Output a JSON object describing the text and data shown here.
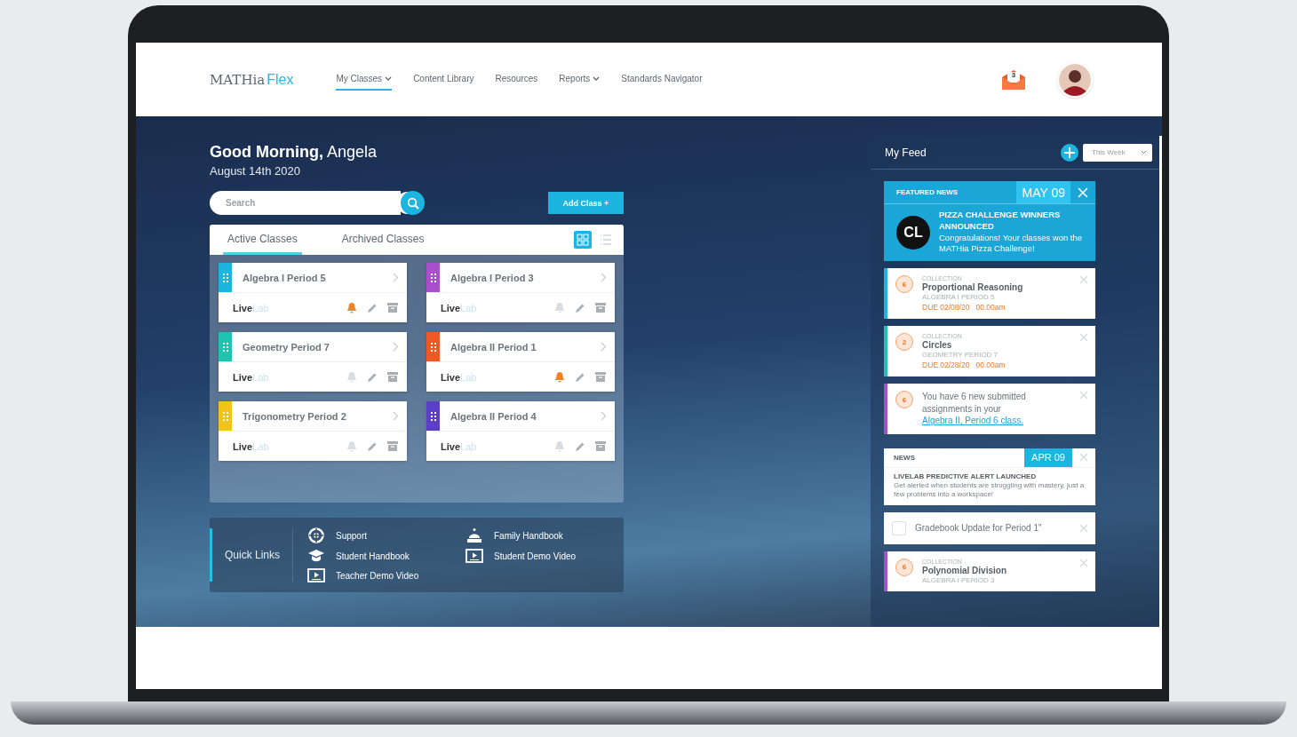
{
  "nav": {
    "logo_main": "MATHia",
    "logo_accent": "Flex",
    "items": [
      {
        "label": "My Classes",
        "selected": true,
        "dropdown": true
      },
      {
        "label": "Content Library",
        "selected": false,
        "dropdown": false
      },
      {
        "label": "Resources",
        "selected": false,
        "dropdown": false
      },
      {
        "label": "Reports",
        "selected": false,
        "dropdown": true
      },
      {
        "label": "Standards Navigator",
        "selected": false,
        "dropdown": false
      }
    ],
    "inbox_count": "3"
  },
  "greeting": {
    "salutation": "Good Morning,",
    "name": "Angela",
    "date": "August 14th 2020"
  },
  "search": {
    "placeholder": "Search"
  },
  "add_button": "Add Class +",
  "class_tabs": [
    {
      "label": "Active Classes",
      "selected": true
    },
    {
      "label": "Archived Classes",
      "selected": false
    }
  ],
  "view_toggle": [
    {
      "kind": "grid",
      "selected": true
    },
    {
      "kind": "list",
      "selected": false
    }
  ],
  "classes": [
    {
      "name": "Algebra I Period 5",
      "color": "#1cb5e0",
      "alert": true,
      "tool": "Live",
      "tool_suffix": "Lab"
    },
    {
      "name": "Algebra I Period 3",
      "color": "#a94fc9",
      "alert": false,
      "tool": "Live",
      "tool_suffix": "Lab"
    },
    {
      "name": "Geometry Period 7",
      "color": "#1fc4b0",
      "alert": false,
      "tool": "Live",
      "tool_suffix": "Lab"
    },
    {
      "name": "Algebra II Period 1",
      "color": "#ef5a24",
      "alert": true,
      "tool": "Live",
      "tool_suffix": "Lab"
    },
    {
      "name": "Trigonometry Period 2",
      "color": "#f2c318",
      "alert": false,
      "tool": "Live",
      "tool_suffix": "Lab"
    },
    {
      "name": "Algebra II Period 4",
      "color": "#5b3fc7",
      "alert": false,
      "tool": "Live",
      "tool_suffix": "Lab"
    }
  ],
  "quick_links": {
    "title": "Quick Links",
    "links": [
      {
        "label": "Support",
        "kind": "support"
      },
      {
        "label": "Family Handbook",
        "kind": "family"
      },
      {
        "label": "Student Handbook",
        "kind": "handbook"
      },
      {
        "label": "Student Demo Video",
        "kind": "video"
      },
      {
        "label": "Teacher Demo Video",
        "kind": "video"
      }
    ]
  },
  "feed": {
    "title": "My Feed",
    "filter": "This Week",
    "items": [
      {
        "kind": "featured",
        "label": "FEATURED NEWS",
        "date": "MAY 09",
        "logo": "CL",
        "headline": "PIZZA CHALLENGE WINNERS ANNOUNCED",
        "body": "Congratulations! Your classes won the MATHia Pizza Challenge!"
      },
      {
        "kind": "collection",
        "color": "#1cb5e0",
        "count": "6",
        "label": "COLLECTION",
        "title": "Proportional Reasoning",
        "class": "ALGEBRA I PERIOD 5",
        "due": "DUE 02/08/20   00.00am"
      },
      {
        "kind": "collection",
        "color": "#1fc4b0",
        "count": "2",
        "label": "COLLECTION",
        "title": "Circles",
        "class": "GEOMETRY PERIOD 7",
        "due": "DUE 02/28/20   00.00am"
      },
      {
        "kind": "message",
        "color": "#a94fc9",
        "count": "6",
        "text": "You have 6 new submitted assignments in your",
        "link": "Algebra II, Period 6 class."
      },
      {
        "kind": "news",
        "label": "NEWS",
        "date": "APR 09",
        "headline": "LIVELAB PREDICTIVE ALERT LAUNCHED",
        "body": "Get alerted when students are struggling with mastery, just a few problems into a workspace!"
      },
      {
        "kind": "task",
        "checked": false,
        "text": "Gradebook Update for Period 1\""
      },
      {
        "kind": "collection",
        "color": "#a94fc9",
        "count": "6",
        "label": "COLLECTION",
        "title": "Polynomial Division",
        "class": "ALGEBRA I PERIOD 3"
      }
    ]
  }
}
